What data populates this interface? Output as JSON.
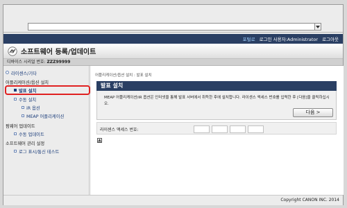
{
  "browser": {
    "address_value": ""
  },
  "topbar": {
    "portal": "포털로",
    "login_user": "로그인 사용자:Administrator",
    "logout": "로그아웃"
  },
  "header": {
    "title": "소프트웨어 등록/업데이트"
  },
  "device": {
    "label": "디바이스 시리얼 번호:",
    "value": "ZZZ99999"
  },
  "sidebar": {
    "license_other": "라이센스/기타",
    "meap_app_section": "어플리케이션/옵션 설치",
    "install_release": "발표 설치",
    "manual_install": "수동 설치",
    "ir_options": "iR 옵션",
    "meap_app": "MEAP 어플리케이션",
    "firmware_update": "펌웨어 업데이트",
    "manual_update": "수동 업데이트",
    "software_mgmt": "소프트웨어 관리 설정",
    "log_display": "로그 표시/통신 테스트"
  },
  "main": {
    "breadcrumb": "어플리케이션/옵션 설치 : 발표 설치",
    "panel_title": "발표 설치",
    "description": "MEAP 어플리케이션/iR 옵션은 인터넷을 통해 발표 서버에서 취득한 후에 설치합니다. 라이센스 액세스 번호를 입력한 후 [다음]을 클릭하십시오.",
    "next_button": "다음 >",
    "license_label": "라이센스 액세스 번호:"
  },
  "footer": {
    "copyright": "Copyright CANON INC. 2014"
  },
  "colors": {
    "accent": "#2a3f63",
    "link": "#1a3c7a",
    "highlight_border": "#e02020"
  }
}
